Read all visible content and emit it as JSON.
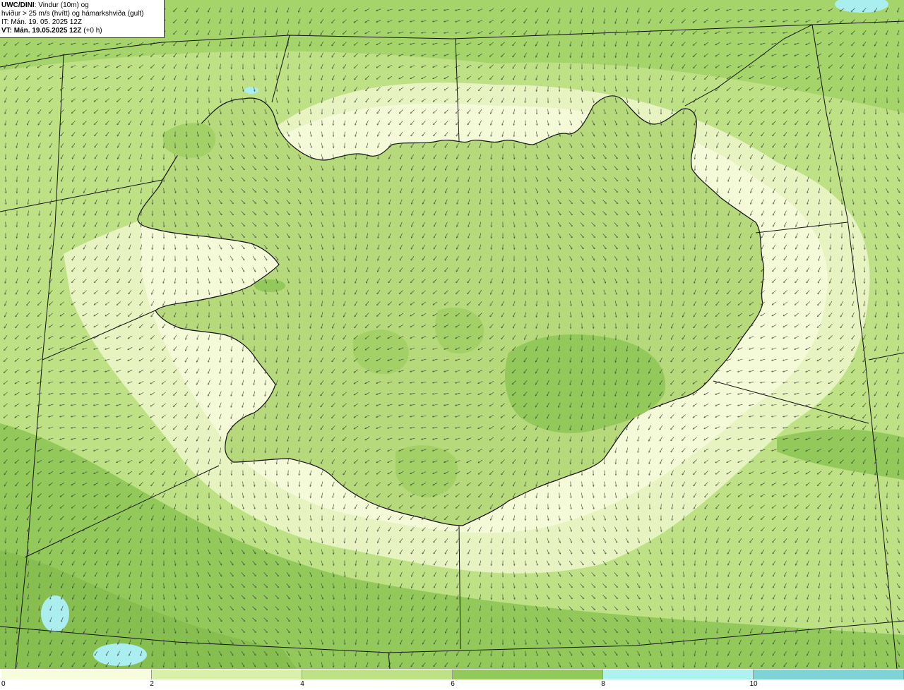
{
  "info": {
    "model": "UWC/DINI",
    "title_suffix": ": Vindur (10m) og",
    "line2": "hviður > 25 m/s (hvítt) og hámarkshviða (gult)",
    "init_time": "IT: Mán. 19. 05. 2025 12Z",
    "valid_time": "VT: Mán. 19.05.2025 12Z",
    "lead": "(+0 h)"
  },
  "legend": {
    "ticks": [
      "0",
      "2",
      "4",
      "6",
      "8",
      "10"
    ],
    "colors": [
      "#f7fcdc",
      "#d8f0a8",
      "#bde184",
      "#93c95a",
      "#aef2f0",
      "#7dd4d3"
    ]
  },
  "map_colors": {
    "land_fill": "#b6d97c",
    "lake": "#aaeef0",
    "coast": "#111111",
    "arrow": "#3a3a3a",
    "grid_line": "#111111"
  }
}
